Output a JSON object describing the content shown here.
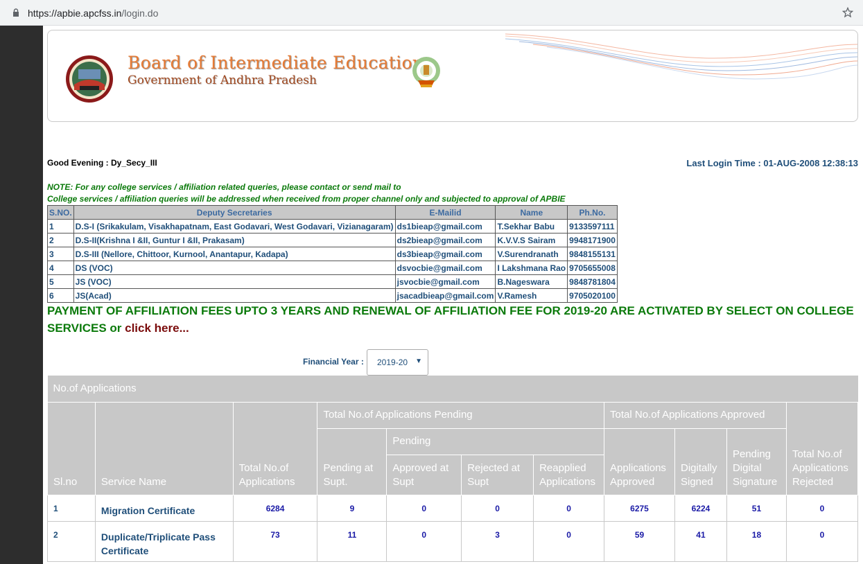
{
  "browser": {
    "url_host": "https://apbie.apcfss.in",
    "url_path": "/login.do"
  },
  "header": {
    "title": "Board of Intermediate Education",
    "subtitle": "Government of Andhra Pradesh"
  },
  "greeting": "Good Evening : Dy_Secy_III",
  "last_login": "Last Login Time : 01-AUG-2008 12:38:13",
  "note_line1": "NOTE: For any college services / affiliation related queries, please contact or send mail to",
  "note_line2": "College services / affiliation queries will be addressed when received from proper channel only and subjected to approval of APBIE",
  "contacts": {
    "headers": [
      "S.NO.",
      "Deputy Secretaries",
      "E-Mailid",
      "Name",
      "Ph.No."
    ],
    "rows": [
      [
        "1",
        "D.S-I (Srikakulam, Visakhapatnam, East Godavari, West Godavari, Vizianagaram)",
        "ds1bieap@gmail.com",
        "T.Sekhar Babu",
        "9133597111"
      ],
      [
        "2",
        "D.S-II(Krishna I &II, Guntur I &II, Prakasam)",
        "ds2bieap@gmail.com",
        "K.V.V.S Sairam",
        "9948171900"
      ],
      [
        "3",
        "D.S-III (Nellore, Chittoor, Kurnool, Anantapur, Kadapa)",
        "ds3bieap@gmail.com",
        "V.Surendranath",
        "9848155131"
      ],
      [
        "4",
        "DS (VOC)",
        "dsvocbie@gmail.com",
        "I Lakshmana Rao",
        "9705655008"
      ],
      [
        "5",
        "JS (VOC)",
        "jsvocbie@gmail.com",
        "B.Nageswara",
        "9848781804"
      ],
      [
        "6",
        "JS(Acad)",
        "jsacadbieap@gmail.com",
        "V.Ramesh",
        "9705020100"
      ]
    ]
  },
  "payment_notice": "PAYMENT OF AFFILIATION FEES UPTO 3 YEARS AND RENEWAL OF AFFILIATION FEE FOR 2019-20 ARE ACTIVATED BY SELECT ON COLLEGE SERVICES or",
  "payment_link": "click here...",
  "financial_year": {
    "label": "Financial Year :",
    "selected": "2019-20"
  },
  "applications": {
    "caption": "No.of Applications",
    "group_pending": "Total No.of Applications Pending",
    "group_pending_sub": "Pending",
    "group_approved": "Total No.of Applications Approved",
    "columns": {
      "slno": "Sl.no",
      "service": "Service Name",
      "total": "Total No.of Applications",
      "pending_supt": "Pending at Supt.",
      "approved_supt": "Approved at Supt",
      "rejected_supt": "Rejected at Supt",
      "reapplied": "Reapplied Applications",
      "approved": "Applications Approved",
      "signed": "Digitally Signed",
      "pending_sig": "Pending Digital Signature",
      "rejected": "Total No.of Applications Rejected"
    },
    "rows": [
      [
        "1",
        "Migration Certificate",
        "6284",
        "9",
        "0",
        "0",
        "0",
        "6275",
        "6224",
        "51",
        "0"
      ],
      [
        "2",
        "Duplicate/Triplicate Pass Certificate",
        "73",
        "11",
        "0",
        "3",
        "0",
        "59",
        "41",
        "18",
        "0"
      ]
    ]
  }
}
